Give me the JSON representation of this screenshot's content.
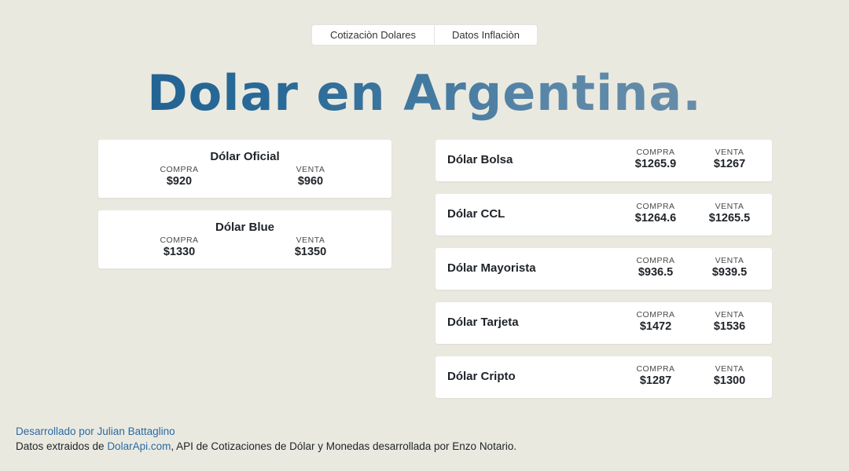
{
  "tabs": [
    {
      "label": "Cotizaciòn Dolares"
    },
    {
      "label": "Datos Inflaciòn"
    }
  ],
  "title": "Dolar en Argentina.",
  "labels": {
    "buy": "COMPRA",
    "sell": "VENTA"
  },
  "left_cards": [
    {
      "name": "Dólar Oficial",
      "buy": "$920",
      "sell": "$960"
    },
    {
      "name": "Dólar Blue",
      "buy": "$1330",
      "sell": "$1350"
    }
  ],
  "right_cards": [
    {
      "name": "Dólar Bolsa",
      "buy": "$1265.9",
      "sell": "$1267"
    },
    {
      "name": "Dólar CCL",
      "buy": "$1264.6",
      "sell": "$1265.5"
    },
    {
      "name": "Dólar Mayorista",
      "buy": "$936.5",
      "sell": "$939.5"
    },
    {
      "name": "Dólar Tarjeta",
      "buy": "$1472",
      "sell": "$1536"
    },
    {
      "name": "Dólar Cripto",
      "buy": "$1287",
      "sell": "$1300"
    }
  ],
  "footer": {
    "developer": "Desarrollado por Julian Battaglino",
    "source_prefix": "Datos extraidos de ",
    "source_link": "DolarApi.com",
    "source_suffix": ", API de Cotizaciones de Dólar y Monedas desarrollada por Enzo Notario."
  },
  "colors": {
    "background": "#eae9e0",
    "title_start": "#1a5c8f",
    "title_end": "#7393aa",
    "link": "#2a6aa5"
  }
}
